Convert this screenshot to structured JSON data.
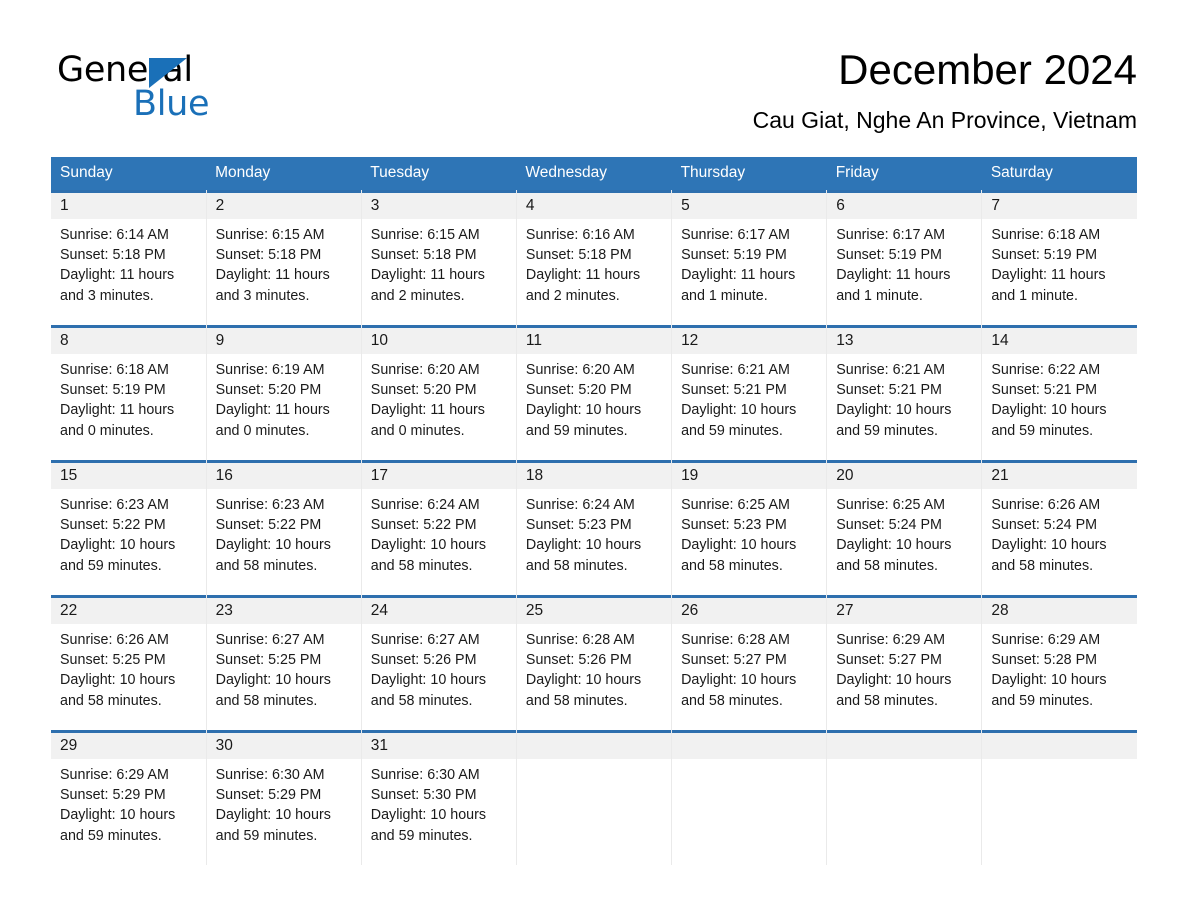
{
  "brand": {
    "logo_text_primary": "General",
    "logo_text_secondary": "Blue",
    "logo_color": "#1a70b8"
  },
  "header": {
    "title": "December 2024",
    "subtitle": "Cau Giat, Nghe An Province, Vietnam"
  },
  "theme": {
    "header_bar_color": "#2e75b6",
    "row_rule_color": "#2e6fae",
    "daynum_band_color": "#f1f1f1",
    "text_color": "#1a1a1a"
  },
  "weekday_headers": [
    "Sunday",
    "Monday",
    "Tuesday",
    "Wednesday",
    "Thursday",
    "Friday",
    "Saturday"
  ],
  "weeks": [
    [
      {
        "day": "1",
        "sunrise": "Sunrise: 6:14 AM",
        "sunset": "Sunset: 5:18 PM",
        "daylight_1": "Daylight: 11 hours",
        "daylight_2": "and 3 minutes."
      },
      {
        "day": "2",
        "sunrise": "Sunrise: 6:15 AM",
        "sunset": "Sunset: 5:18 PM",
        "daylight_1": "Daylight: 11 hours",
        "daylight_2": "and 3 minutes."
      },
      {
        "day": "3",
        "sunrise": "Sunrise: 6:15 AM",
        "sunset": "Sunset: 5:18 PM",
        "daylight_1": "Daylight: 11 hours",
        "daylight_2": "and 2 minutes."
      },
      {
        "day": "4",
        "sunrise": "Sunrise: 6:16 AM",
        "sunset": "Sunset: 5:18 PM",
        "daylight_1": "Daylight: 11 hours",
        "daylight_2": "and 2 minutes."
      },
      {
        "day": "5",
        "sunrise": "Sunrise: 6:17 AM",
        "sunset": "Sunset: 5:19 PM",
        "daylight_1": "Daylight: 11 hours",
        "daylight_2": "and 1 minute."
      },
      {
        "day": "6",
        "sunrise": "Sunrise: 6:17 AM",
        "sunset": "Sunset: 5:19 PM",
        "daylight_1": "Daylight: 11 hours",
        "daylight_2": "and 1 minute."
      },
      {
        "day": "7",
        "sunrise": "Sunrise: 6:18 AM",
        "sunset": "Sunset: 5:19 PM",
        "daylight_1": "Daylight: 11 hours",
        "daylight_2": "and 1 minute."
      }
    ],
    [
      {
        "day": "8",
        "sunrise": "Sunrise: 6:18 AM",
        "sunset": "Sunset: 5:19 PM",
        "daylight_1": "Daylight: 11 hours",
        "daylight_2": "and 0 minutes."
      },
      {
        "day": "9",
        "sunrise": "Sunrise: 6:19 AM",
        "sunset": "Sunset: 5:20 PM",
        "daylight_1": "Daylight: 11 hours",
        "daylight_2": "and 0 minutes."
      },
      {
        "day": "10",
        "sunrise": "Sunrise: 6:20 AM",
        "sunset": "Sunset: 5:20 PM",
        "daylight_1": "Daylight: 11 hours",
        "daylight_2": "and 0 minutes."
      },
      {
        "day": "11",
        "sunrise": "Sunrise: 6:20 AM",
        "sunset": "Sunset: 5:20 PM",
        "daylight_1": "Daylight: 10 hours",
        "daylight_2": "and 59 minutes."
      },
      {
        "day": "12",
        "sunrise": "Sunrise: 6:21 AM",
        "sunset": "Sunset: 5:21 PM",
        "daylight_1": "Daylight: 10 hours",
        "daylight_2": "and 59 minutes."
      },
      {
        "day": "13",
        "sunrise": "Sunrise: 6:21 AM",
        "sunset": "Sunset: 5:21 PM",
        "daylight_1": "Daylight: 10 hours",
        "daylight_2": "and 59 minutes."
      },
      {
        "day": "14",
        "sunrise": "Sunrise: 6:22 AM",
        "sunset": "Sunset: 5:21 PM",
        "daylight_1": "Daylight: 10 hours",
        "daylight_2": "and 59 minutes."
      }
    ],
    [
      {
        "day": "15",
        "sunrise": "Sunrise: 6:23 AM",
        "sunset": "Sunset: 5:22 PM",
        "daylight_1": "Daylight: 10 hours",
        "daylight_2": "and 59 minutes."
      },
      {
        "day": "16",
        "sunrise": "Sunrise: 6:23 AM",
        "sunset": "Sunset: 5:22 PM",
        "daylight_1": "Daylight: 10 hours",
        "daylight_2": "and 58 minutes."
      },
      {
        "day": "17",
        "sunrise": "Sunrise: 6:24 AM",
        "sunset": "Sunset: 5:22 PM",
        "daylight_1": "Daylight: 10 hours",
        "daylight_2": "and 58 minutes."
      },
      {
        "day": "18",
        "sunrise": "Sunrise: 6:24 AM",
        "sunset": "Sunset: 5:23 PM",
        "daylight_1": "Daylight: 10 hours",
        "daylight_2": "and 58 minutes."
      },
      {
        "day": "19",
        "sunrise": "Sunrise: 6:25 AM",
        "sunset": "Sunset: 5:23 PM",
        "daylight_1": "Daylight: 10 hours",
        "daylight_2": "and 58 minutes."
      },
      {
        "day": "20",
        "sunrise": "Sunrise: 6:25 AM",
        "sunset": "Sunset: 5:24 PM",
        "daylight_1": "Daylight: 10 hours",
        "daylight_2": "and 58 minutes."
      },
      {
        "day": "21",
        "sunrise": "Sunrise: 6:26 AM",
        "sunset": "Sunset: 5:24 PM",
        "daylight_1": "Daylight: 10 hours",
        "daylight_2": "and 58 minutes."
      }
    ],
    [
      {
        "day": "22",
        "sunrise": "Sunrise: 6:26 AM",
        "sunset": "Sunset: 5:25 PM",
        "daylight_1": "Daylight: 10 hours",
        "daylight_2": "and 58 minutes."
      },
      {
        "day": "23",
        "sunrise": "Sunrise: 6:27 AM",
        "sunset": "Sunset: 5:25 PM",
        "daylight_1": "Daylight: 10 hours",
        "daylight_2": "and 58 minutes."
      },
      {
        "day": "24",
        "sunrise": "Sunrise: 6:27 AM",
        "sunset": "Sunset: 5:26 PM",
        "daylight_1": "Daylight: 10 hours",
        "daylight_2": "and 58 minutes."
      },
      {
        "day": "25",
        "sunrise": "Sunrise: 6:28 AM",
        "sunset": "Sunset: 5:26 PM",
        "daylight_1": "Daylight: 10 hours",
        "daylight_2": "and 58 minutes."
      },
      {
        "day": "26",
        "sunrise": "Sunrise: 6:28 AM",
        "sunset": "Sunset: 5:27 PM",
        "daylight_1": "Daylight: 10 hours",
        "daylight_2": "and 58 minutes."
      },
      {
        "day": "27",
        "sunrise": "Sunrise: 6:29 AM",
        "sunset": "Sunset: 5:27 PM",
        "daylight_1": "Daylight: 10 hours",
        "daylight_2": "and 58 minutes."
      },
      {
        "day": "28",
        "sunrise": "Sunrise: 6:29 AM",
        "sunset": "Sunset: 5:28 PM",
        "daylight_1": "Daylight: 10 hours",
        "daylight_2": "and 59 minutes."
      }
    ],
    [
      {
        "day": "29",
        "sunrise": "Sunrise: 6:29 AM",
        "sunset": "Sunset: 5:29 PM",
        "daylight_1": "Daylight: 10 hours",
        "daylight_2": "and 59 minutes."
      },
      {
        "day": "30",
        "sunrise": "Sunrise: 6:30 AM",
        "sunset": "Sunset: 5:29 PM",
        "daylight_1": "Daylight: 10 hours",
        "daylight_2": "and 59 minutes."
      },
      {
        "day": "31",
        "sunrise": "Sunrise: 6:30 AM",
        "sunset": "Sunset: 5:30 PM",
        "daylight_1": "Daylight: 10 hours",
        "daylight_2": "and 59 minutes."
      },
      {
        "day": "",
        "sunrise": "",
        "sunset": "",
        "daylight_1": "",
        "daylight_2": ""
      },
      {
        "day": "",
        "sunrise": "",
        "sunset": "",
        "daylight_1": "",
        "daylight_2": ""
      },
      {
        "day": "",
        "sunrise": "",
        "sunset": "",
        "daylight_1": "",
        "daylight_2": ""
      },
      {
        "day": "",
        "sunrise": "",
        "sunset": "",
        "daylight_1": "",
        "daylight_2": ""
      }
    ]
  ]
}
